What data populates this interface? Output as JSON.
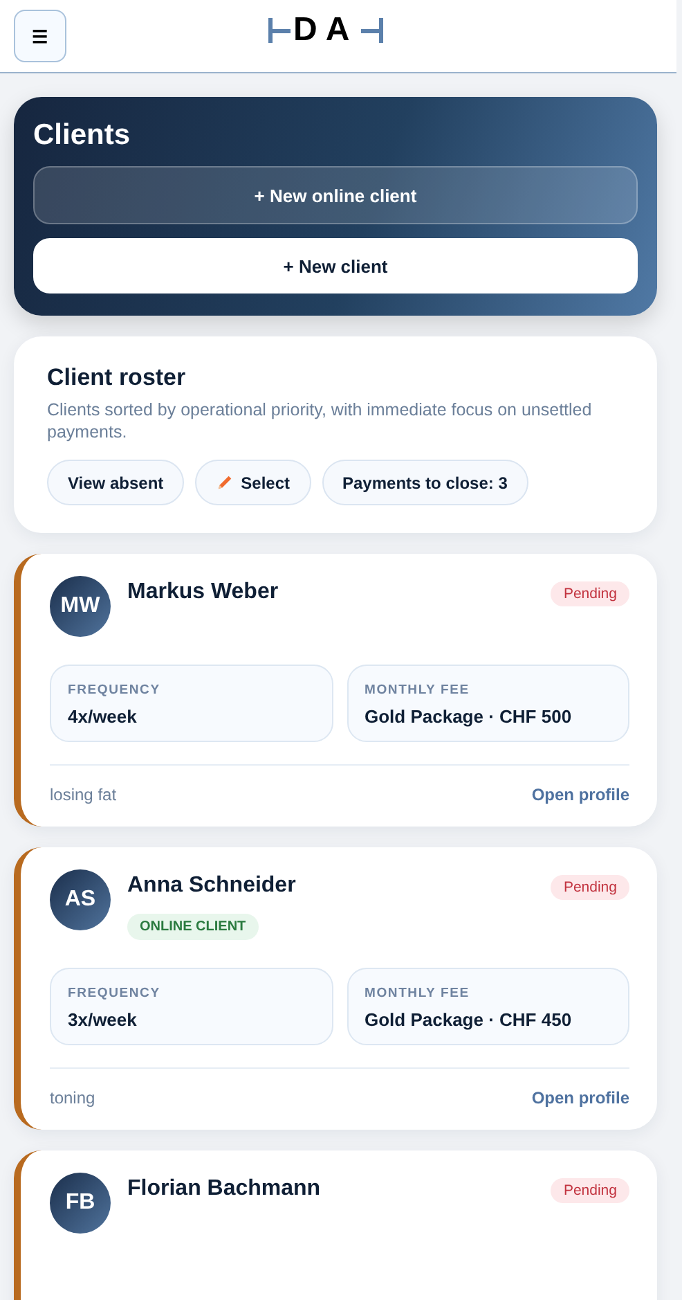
{
  "header": {
    "menu_glyph": "☰",
    "logo": "DA"
  },
  "hero": {
    "title": "Clients",
    "buttons": [
      {
        "label": "+ New online client",
        "kind": "ghost"
      },
      {
        "label": "+ New client",
        "kind": "solid"
      }
    ]
  },
  "roster": {
    "title": "Client roster",
    "description": "Clients sorted by operational priority, with immediate focus on unsettled payments.",
    "actions": [
      {
        "label": "View absent",
        "kind": "plain"
      },
      {
        "label": "Select",
        "kind": "edit"
      },
      {
        "label": "Payments to close: 3",
        "kind": "plain"
      }
    ]
  },
  "clients": [
    {
      "initials": "MW",
      "name": "Markus Weber",
      "status": "Pending",
      "stats": [
        {
          "label": "FREQUENCY",
          "value": "4x/week"
        },
        {
          "label": "MONTHLY FEE",
          "value": "Gold Package · CHF 500"
        }
      ],
      "goal": "losing fat",
      "link": "Open profile"
    },
    {
      "initials": "AS",
      "name": "Anna Schneider",
      "status": "Pending",
      "tags": [
        "ONLINE CLIENT"
      ],
      "stats": [
        {
          "label": "FREQUENCY",
          "value": "3x/week"
        },
        {
          "label": "MONTHLY FEE",
          "value": "Gold Package · CHF 450"
        }
      ],
      "goal": "toning",
      "link": "Open profile"
    },
    {
      "initials": "FB",
      "name": "Florian Bachmann",
      "status": "Pending"
    }
  ]
}
